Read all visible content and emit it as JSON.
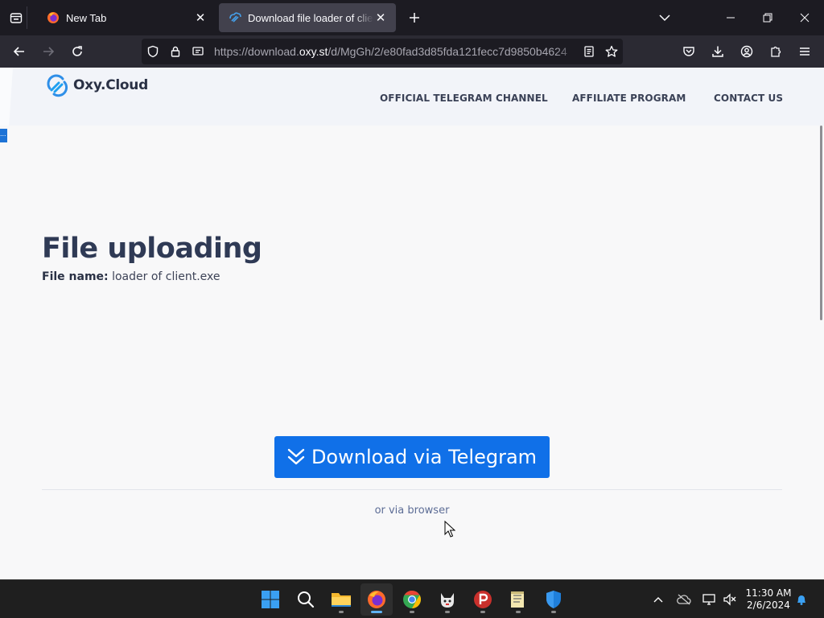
{
  "browser": {
    "tabs": [
      {
        "title": "New Tab",
        "active": false
      },
      {
        "title": "Download file loader of client.exe",
        "active": true
      }
    ],
    "url": {
      "prefix": "https://download.",
      "domain": "oxy.st",
      "path": "/d/MgGh/2/e80fad3d85fda121fecc7d9850b4624"
    }
  },
  "site": {
    "logo_text": "Oxy.Cloud",
    "nav": [
      "OFFICIAL TELEGRAM CHANNEL",
      "AFFILIATE PROGRAM",
      "CONTACT US"
    ],
    "side_chip": "..."
  },
  "main": {
    "title": "File uploading",
    "file_label": "File name:",
    "file_name": "loader of client.exe",
    "download_button": "Download via Telegram",
    "alt_link": "or via browser"
  },
  "taskbar": {
    "time": "11:30 AM",
    "date": "2/6/2024"
  },
  "colors": {
    "brand": "#1070e8",
    "title": "#2f3a55",
    "browser_dark": "#1c1b22"
  }
}
